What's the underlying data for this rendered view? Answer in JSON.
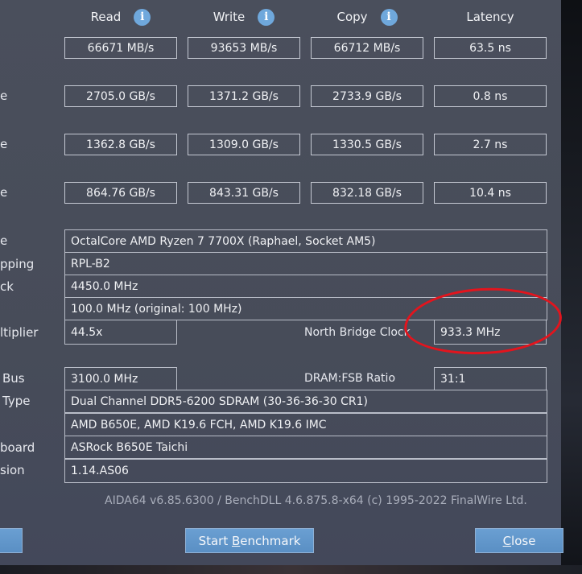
{
  "headers": {
    "read": "Read",
    "write": "Write",
    "copy": "Copy",
    "latency": "Latency"
  },
  "bench_rows": [
    {
      "label": "",
      "read": "66671 MB/s",
      "write": "93653 MB/s",
      "copy": "66712 MB/s",
      "latency": "63.5 ns"
    },
    {
      "label": "e",
      "read": "2705.0 GB/s",
      "write": "1371.2 GB/s",
      "copy": "2733.9 GB/s",
      "latency": "0.8 ns"
    },
    {
      "label": "e",
      "read": "1362.8 GB/s",
      "write": "1309.0 GB/s",
      "copy": "1330.5 GB/s",
      "latency": "2.7 ns"
    },
    {
      "label": "e",
      "read": "864.76 GB/s",
      "write": "843.31 GB/s",
      "copy": "832.18 GB/s",
      "latency": "10.4 ns"
    }
  ],
  "info": {
    "cpu_type_label": "e",
    "cpu_type": "OctalCore AMD Ryzen 7 7700X  (Raphael, Socket AM5)",
    "stepping_label": "pping",
    "stepping": "RPL-B2",
    "clock_label": "ck",
    "clock": "4450.0 MHz",
    "fsb": "100.0 MHz  (original: 100 MHz)",
    "multiplier_label": "ltiplier",
    "multiplier": "44.5x",
    "nb_clock_label": "North Bridge Clock",
    "nb_clock": "933.3 MHz",
    "bus_label": "Bus",
    "bus": "3100.0 MHz",
    "ratio_label": "DRAM:FSB Ratio",
    "ratio": "31:1",
    "type_label": "Type",
    "mem_type": "Dual Channel DDR5-6200 SDRAM  (30-36-36-30 CR1)",
    "chipset": "AMD B650E, AMD K19.6 FCH, AMD K19.6 IMC",
    "board_label": "board",
    "board": "ASRock B650E Taichi",
    "bios_label": "sion",
    "bios": "1.14.AS06"
  },
  "footer": "AIDA64 v6.85.6300 / BenchDLL 4.6.875.8-x64  (c) 1995-2022 FinalWire Ltd.",
  "buttons": {
    "start_prefix": "Start ",
    "start_accel": "B",
    "start_suffix": "enchmark",
    "close_accel": "C",
    "close_suffix": "lose"
  },
  "colors": {
    "panel": "#474c59",
    "button": "#5f94c9",
    "annotation": "#e3141d",
    "info_icon": "#6fa8dc"
  },
  "icons": [
    "info-icon"
  ]
}
